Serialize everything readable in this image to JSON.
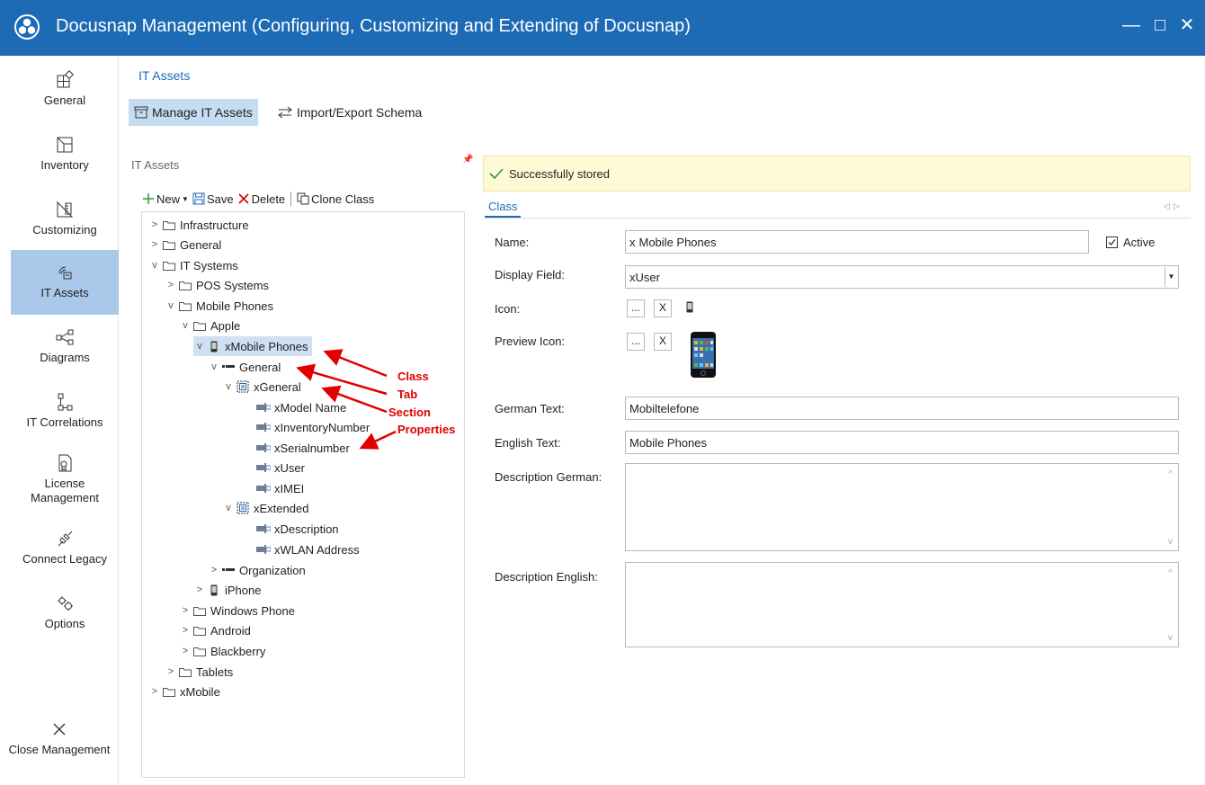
{
  "window": {
    "title": "Docusnap Management (Configuring, Customizing and Extending of Docusnap)",
    "minimize": "—",
    "maximize": "□",
    "close": "✕"
  },
  "nav": {
    "items": [
      {
        "label": "General",
        "icon": "general-icon"
      },
      {
        "label": "Inventory",
        "icon": "inventory-icon"
      },
      {
        "label": "Customizing",
        "icon": "customizing-icon"
      },
      {
        "label": "IT Assets",
        "icon": "it-assets-icon"
      },
      {
        "label": "Diagrams",
        "icon": "diagrams-icon"
      },
      {
        "label": "IT Correlations",
        "icon": "it-correlations-icon"
      },
      {
        "label": "License Management",
        "icon": "license-icon"
      },
      {
        "label": "Connect Legacy",
        "icon": "connect-icon"
      },
      {
        "label": "Options",
        "icon": "options-icon"
      }
    ],
    "close_label": "Close Management",
    "active": "IT Assets"
  },
  "header": {
    "breadcrumb": "IT Assets",
    "tab_manage": "Manage IT Assets",
    "tab_import": "Import/Export Schema"
  },
  "tree_panel": {
    "title": "IT Assets",
    "toolbar": {
      "new": "New",
      "save": "Save",
      "delete": "Delete",
      "clone": "Clone Class"
    },
    "nodes": [
      {
        "label": "Infrastructure",
        "type": "folder",
        "expanded": false
      },
      {
        "label": "General",
        "type": "folder",
        "expanded": false
      },
      {
        "label": "IT Systems",
        "type": "folder",
        "expanded": true
      },
      {
        "label": "POS Systems",
        "type": "folder",
        "expanded": false
      },
      {
        "label": "Mobile Phones",
        "type": "folder",
        "expanded": true
      },
      {
        "label": "Apple",
        "type": "folder",
        "expanded": true
      },
      {
        "label": "xMobile Phones",
        "type": "class",
        "expanded": true,
        "selected": true
      },
      {
        "label": "General",
        "type": "tab",
        "expanded": true
      },
      {
        "label": "xGeneral",
        "type": "section",
        "expanded": true
      },
      {
        "label": "xModel Name",
        "type": "property"
      },
      {
        "label": "xInventoryNumber",
        "type": "property"
      },
      {
        "label": "xSerialnumber",
        "type": "property"
      },
      {
        "label": "xUser",
        "type": "property"
      },
      {
        "label": "xIMEI",
        "type": "property"
      },
      {
        "label": "xExtended",
        "type": "section",
        "expanded": true
      },
      {
        "label": "xDescription",
        "type": "property"
      },
      {
        "label": "xWLAN Address",
        "type": "property"
      },
      {
        "label": "Organization",
        "type": "tab",
        "expanded": false
      },
      {
        "label": "iPhone",
        "type": "class",
        "expanded": false
      },
      {
        "label": "Windows Phone",
        "type": "folder",
        "expanded": false
      },
      {
        "label": "Android",
        "type": "folder",
        "expanded": false
      },
      {
        "label": "Blackberry",
        "type": "folder",
        "expanded": false
      },
      {
        "label": "Tablets",
        "type": "folder",
        "expanded": false
      },
      {
        "label": "xMobile",
        "type": "folder",
        "expanded": false
      }
    ],
    "annotations": [
      "Class",
      "Tab",
      "Section",
      "Properties"
    ]
  },
  "detail": {
    "status": "Successfully stored",
    "tab": "Class",
    "fields": {
      "name_label": "Name:",
      "name_prefix": "x",
      "name_value": "Mobile Phones",
      "active_label": "Active",
      "active_checked": true,
      "display_field_label": "Display Field:",
      "display_field_value": "xUser",
      "icon_label": "Icon:",
      "preview_icon_label": "Preview Icon:",
      "browse_button": "...",
      "clear_button": "X",
      "german_text_label": "German Text:",
      "german_text_value": "Mobiltelefone",
      "english_text_label": "English Text:",
      "english_text_value": "Mobile Phones",
      "description_german_label": "Description German:",
      "description_english_label": "Description English:"
    }
  },
  "colors": {
    "titlebar": "#1d6ab5",
    "nav_active": "#a9c8ea",
    "annotation": "#e00000",
    "success_bg": "#fffad6"
  }
}
